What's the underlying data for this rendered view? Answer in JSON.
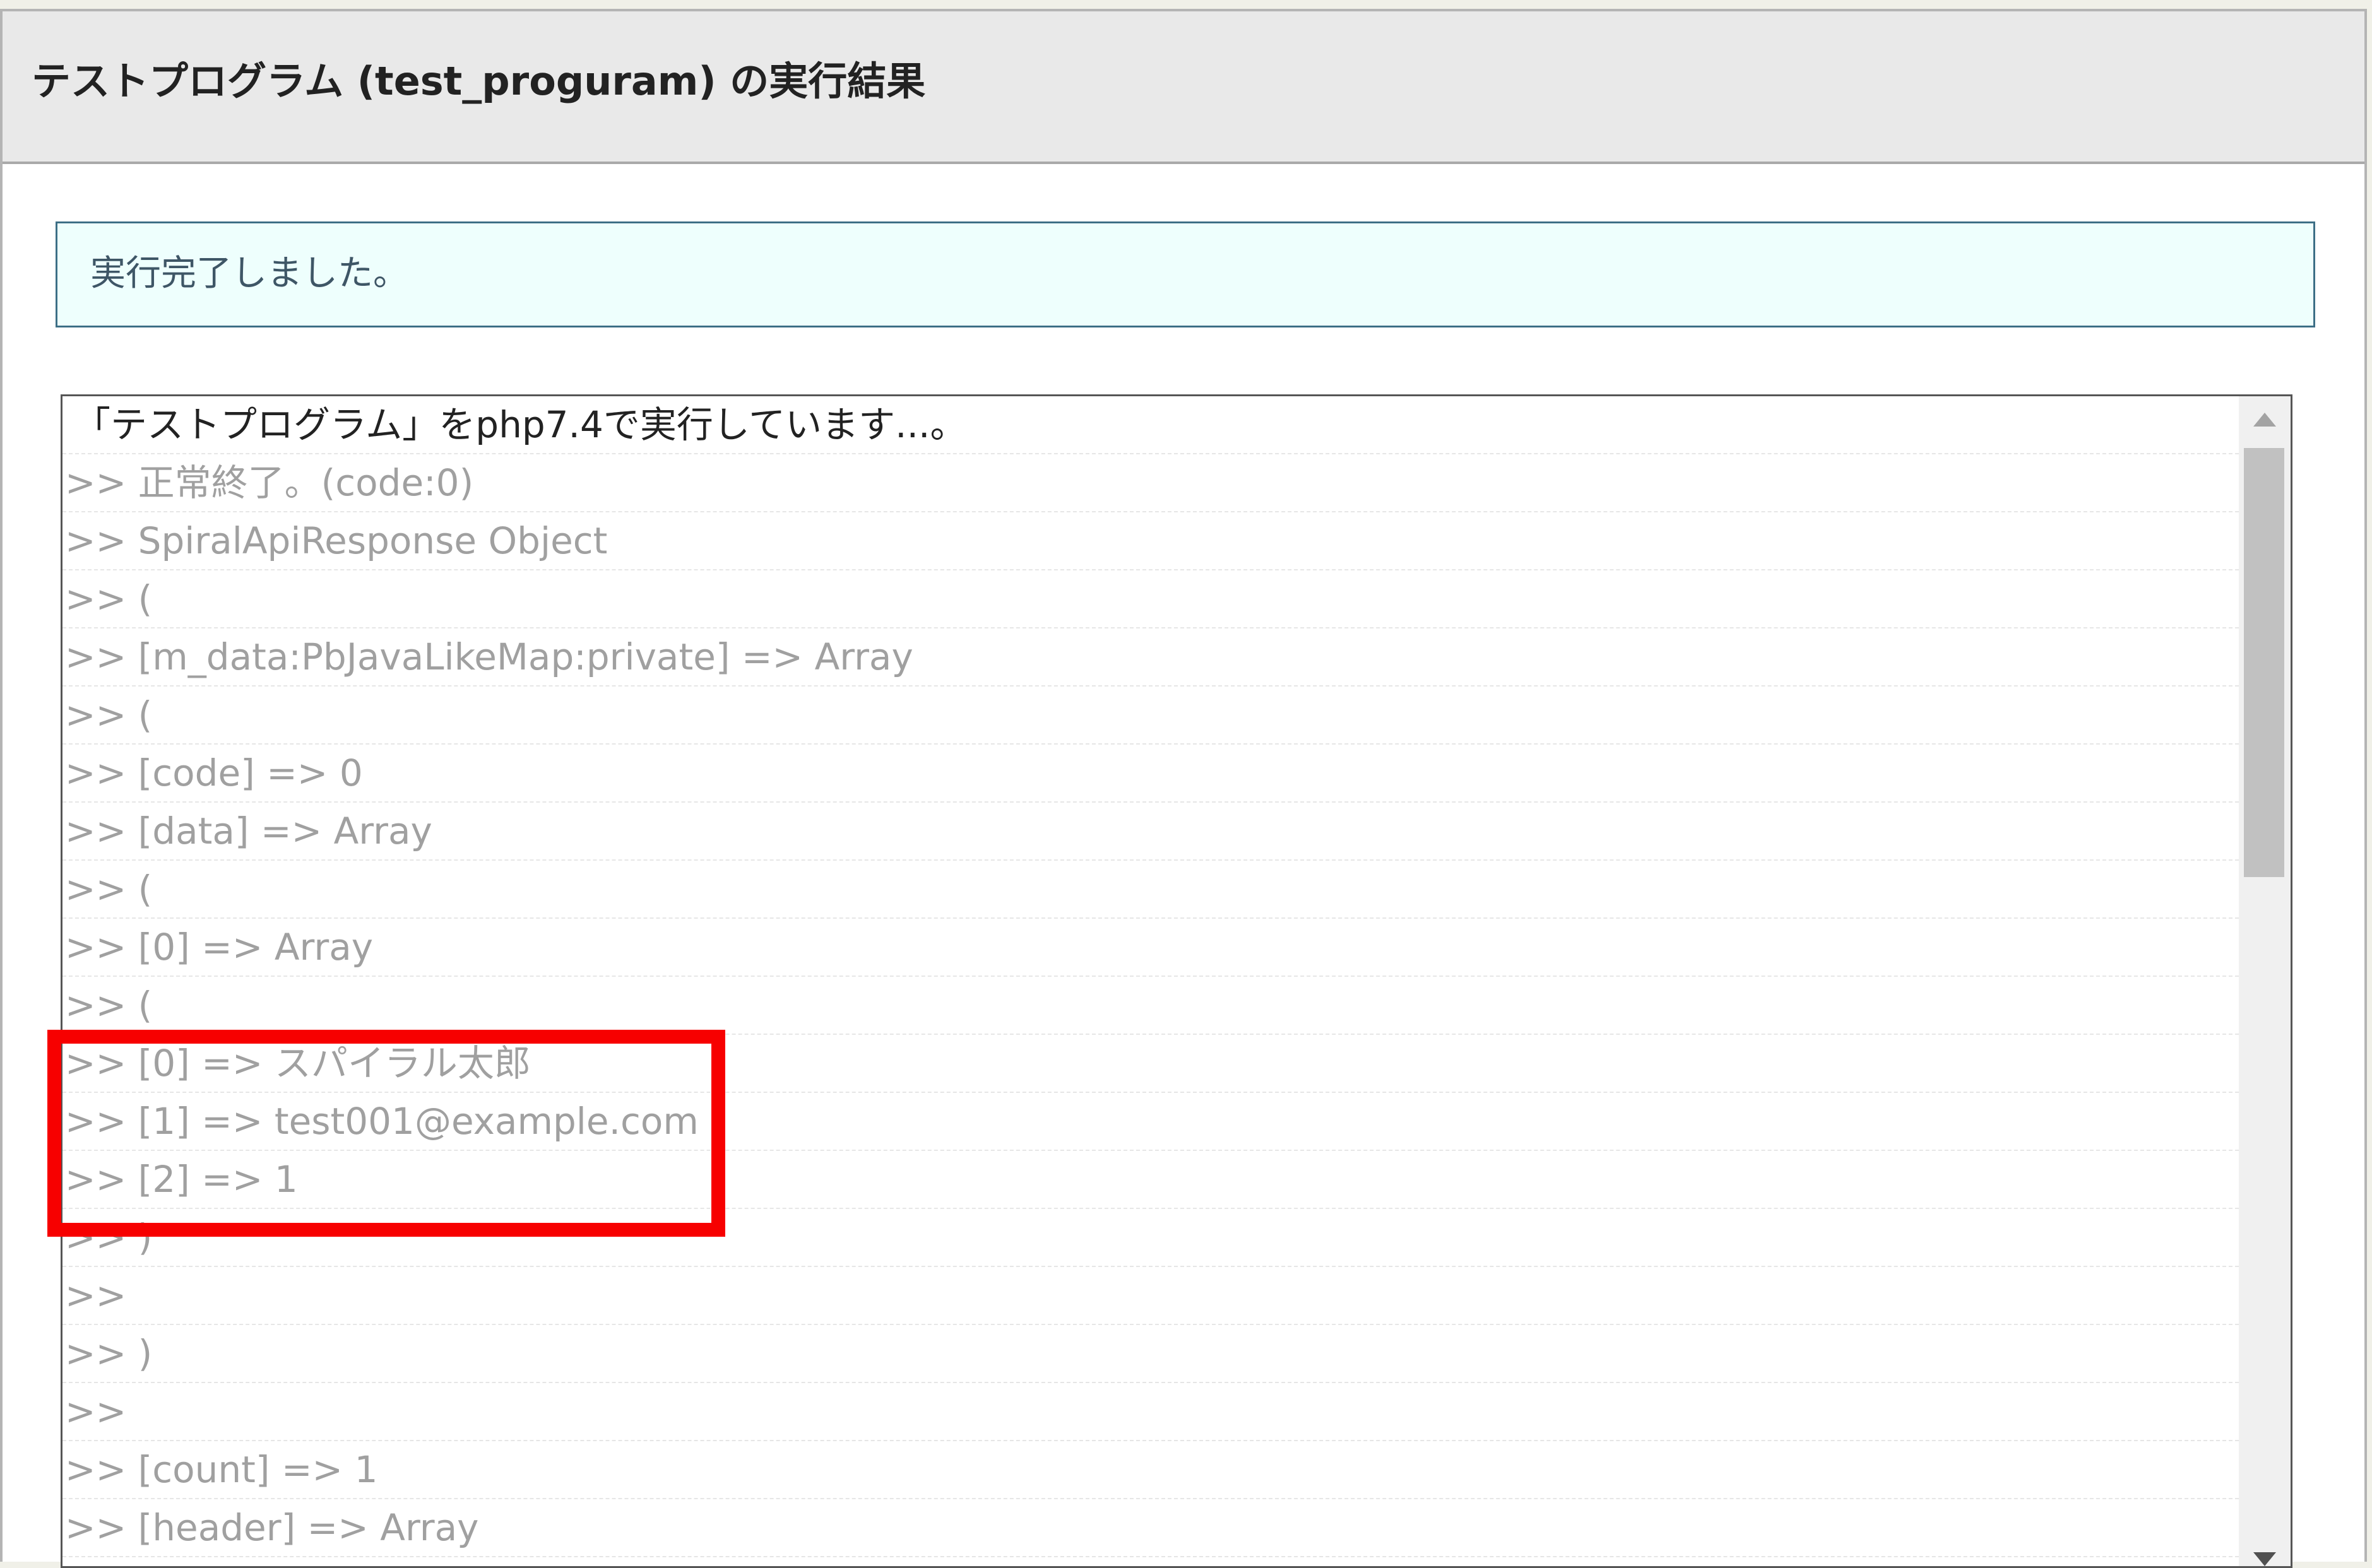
{
  "header": {
    "title": "テストプログラム (test_proguram) の実行結果"
  },
  "notice": {
    "text": "実行完了しました。"
  },
  "log": {
    "lines": [
      "「テストプログラム」をphp7.4で実行しています...。",
      ">> 正常終了。(code:0)",
      ">> SpiralApiResponse Object",
      ">> (",
      ">> [m_data:PbJavaLikeMap:private] => Array",
      ">> (",
      ">> [code] => 0",
      ">> [data] => Array",
      ">> (",
      ">> [0] => Array",
      ">> (",
      ">> [0] => スパイラル太郎",
      ">> [1] => test001@example.com",
      ">> [2] => 1",
      ">> )",
      ">>",
      ">> )",
      ">>",
      ">> [count] => 1",
      ">> [header] => Array",
      ">> ("
    ]
  },
  "colors": {
    "highlight": "#f70000",
    "notice_bg": "#eefffd",
    "notice_border": "#3d6f86",
    "header_bg": "#e9e9e9"
  },
  "icons": {
    "scroll_up": "triangle-up-icon",
    "scroll_down": "triangle-down-icon"
  }
}
